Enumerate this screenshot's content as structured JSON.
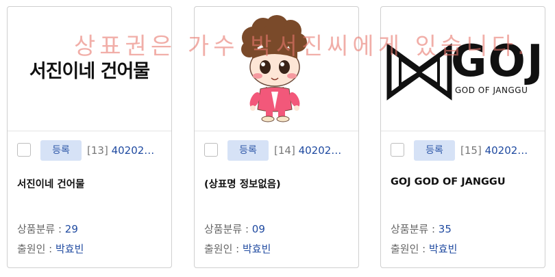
{
  "cards": [
    {
      "thumbnail_text": "서진이네 건어물",
      "status_badge": "등록",
      "index": "[13]",
      "app_number": "40202…",
      "title": "서진이네 건어물",
      "class_label": "상품분류 : ",
      "class_value": "29",
      "applicant_label": "출원인 : ",
      "applicant_value": "박효빈"
    },
    {
      "thumbnail_text": "",
      "status_badge": "등록",
      "index": "[14]",
      "app_number": "40202…",
      "title": "(상표명 정보없음)",
      "class_label": "상품분류 : ",
      "class_value": "09",
      "applicant_label": "출원인 : ",
      "applicant_value": "박효빈"
    },
    {
      "thumbnail_text": "GOJ",
      "thumbnail_subtext": "GOD OF JANGGU",
      "status_badge": "등록",
      "index": "[15]",
      "app_number": "40202…",
      "title": "GOJ GOD OF JANGGU",
      "class_label": "상품분류 : ",
      "class_value": "35",
      "applicant_label": "출원인 : ",
      "applicant_value": "박효빈"
    }
  ],
  "watermark_text": "상표권은 가수 박서진씨에게 있습니다.",
  "colors": {
    "badge_bg": "#d6e2f6",
    "badge_text": "#2f58a8",
    "link_blue": "#1f4aa0",
    "watermark": "#e8786e"
  },
  "icons": [
    "checkbox",
    "cartoon-character-image",
    "bowtie-logo-icon"
  ]
}
